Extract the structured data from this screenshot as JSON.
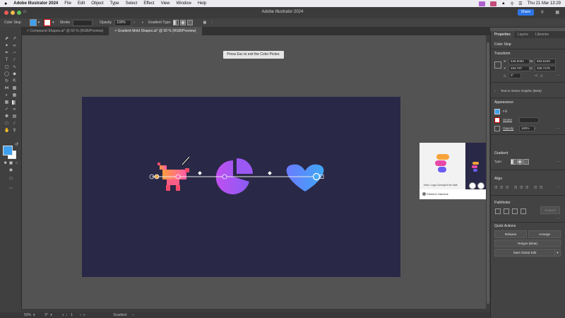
{
  "menubar": {
    "app": "Adobe Illustrator 2024",
    "items": [
      "File",
      "Edit",
      "Object",
      "Type",
      "Select",
      "Effect",
      "View",
      "Window",
      "Help"
    ],
    "clock": "Thu 21 Mar  13:29"
  },
  "window": {
    "title": "Adobe Illustrator 2024",
    "share_label": "Share"
  },
  "control": {
    "mode_label": "Color Stop",
    "stroke_label": "Stroke",
    "opacity_label": "Opacity",
    "opacity_value": "100%",
    "gradient_type_label": "Gradient Type:",
    "fill_color": "#3fa0ee"
  },
  "tabs": [
    {
      "label": "Compound Shapes.ai* @ 50 % (RGB/Preview)",
      "active": false
    },
    {
      "label": "Gradient Mold Shapes.ai* @ 50 % (RGB/Preview)",
      "active": true
    }
  ],
  "canvas": {
    "tooltip": "Press Esc to exit the Color Picker.",
    "artboard_color": "#2a2847"
  },
  "video": {
    "caption": "How I Logo Concept It for Sale",
    "channel": "Sheldon Harbeck"
  },
  "status": {
    "zoom": "50%",
    "rotate": "0°",
    "page": "1",
    "tool": "Gradient"
  },
  "panel": {
    "tabs": [
      "Properties",
      "Layers",
      "Libraries"
    ],
    "context_label": "Color Stop",
    "transform": {
      "title": "Transform",
      "x_label": "X:",
      "x_value": "548.6094",
      "y_label": "Y:",
      "y_value": "483.787",
      "w_label": "W:",
      "w_value": "583.6228",
      "h_label": "H:",
      "h_value": "206.7476",
      "angle_label": "0°"
    },
    "text_to_vector": "Text to Vector Graphic (Beta)",
    "appearance": {
      "title": "Appearance",
      "fill_label": "Fill",
      "stroke_label": "Stroke",
      "opacity_label": "Opacity",
      "opacity_value": "100%"
    },
    "gradient": {
      "title": "Gradient",
      "type_label": "Type:"
    },
    "align_title": "Align",
    "pathfinder": {
      "title": "Pathfinder",
      "expand_label": "Expand"
    },
    "quick_actions": {
      "title": "Quick Actions",
      "release_label": "Release",
      "arrange_label": "Arrange",
      "retype_label": "Retype (Beta)",
      "global_edit_label": "Start Global Edit"
    }
  }
}
